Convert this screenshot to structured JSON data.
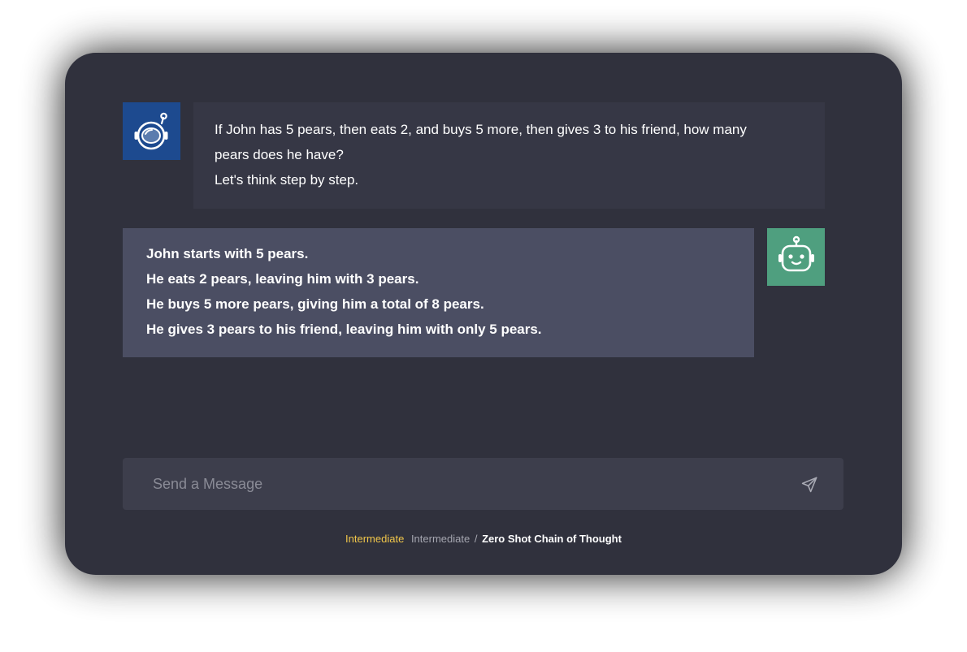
{
  "conversation": {
    "user_message": {
      "avatar_icon": "astronaut-helmet-icon",
      "lines": [
        "If John has 5 pears, then eats 2, and buys 5 more, then gives 3 to his friend, how many",
        "pears does he have?",
        "Let's think step by step."
      ]
    },
    "bot_message": {
      "avatar_icon": "robot-icon",
      "lines": [
        "John starts with 5 pears.",
        "He eats 2 pears, leaving him with 3 pears.",
        "He buys 5 more pears, giving him a total of 8 pears.",
        "He gives 3 pears to his friend, leaving him with only 5 pears."
      ]
    }
  },
  "composer": {
    "placeholder": "Send a Message",
    "send_icon": "send-icon"
  },
  "breadcrumb": {
    "level": "Intermediate",
    "category": "Intermediate",
    "separator": "/",
    "current": "Zero Shot Chain of Thought"
  },
  "colors": {
    "window_bg": "#30313d",
    "user_bubble": "#363745",
    "bot_bubble": "#4b4e63",
    "user_avatar": "#1d4a8f",
    "bot_avatar": "#4f9f7f",
    "level_accent": "#f0c64a"
  }
}
